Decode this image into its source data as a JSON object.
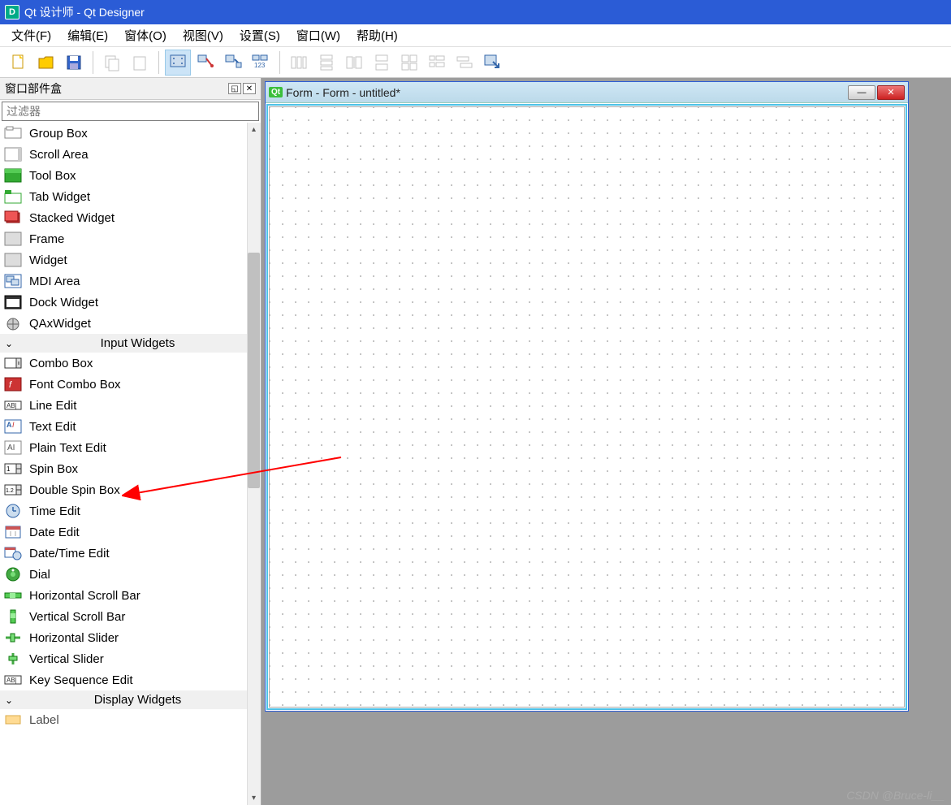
{
  "title": "Qt 设计师 - Qt Designer",
  "menu": [
    "文件(F)",
    "编辑(E)",
    "窗体(O)",
    "视图(V)",
    "设置(S)",
    "窗口(W)",
    "帮助(H)"
  ],
  "dock": {
    "title": "窗口部件盒",
    "filter_placeholder": "过滤器"
  },
  "widgets": {
    "containers": [
      {
        "label": "Group Box",
        "icon": "groupbox"
      },
      {
        "label": "Scroll Area",
        "icon": "scrollarea"
      },
      {
        "label": "Tool Box",
        "icon": "toolbox"
      },
      {
        "label": "Tab Widget",
        "icon": "tabwidget"
      },
      {
        "label": "Stacked Widget",
        "icon": "stacked"
      },
      {
        "label": "Frame",
        "icon": "frame"
      },
      {
        "label": "Widget",
        "icon": "widget"
      },
      {
        "label": "MDI Area",
        "icon": "mdi"
      },
      {
        "label": "Dock Widget",
        "icon": "dock"
      },
      {
        "label": "QAxWidget",
        "icon": "qax"
      }
    ],
    "input_cat": "Input Widgets",
    "inputs": [
      {
        "label": "Combo Box",
        "icon": "combo"
      },
      {
        "label": "Font Combo Box",
        "icon": "fontcombo"
      },
      {
        "label": "Line Edit",
        "icon": "lineedit"
      },
      {
        "label": "Text Edit",
        "icon": "textedit"
      },
      {
        "label": "Plain Text Edit",
        "icon": "plaintext"
      },
      {
        "label": "Spin Box",
        "icon": "spin"
      },
      {
        "label": "Double Spin Box",
        "icon": "dspin"
      },
      {
        "label": "Time Edit",
        "icon": "time"
      },
      {
        "label": "Date Edit",
        "icon": "date"
      },
      {
        "label": "Date/Time Edit",
        "icon": "datetime"
      },
      {
        "label": "Dial",
        "icon": "dial"
      },
      {
        "label": "Horizontal Scroll Bar",
        "icon": "hscroll"
      },
      {
        "label": "Vertical Scroll Bar",
        "icon": "vscroll"
      },
      {
        "label": "Horizontal Slider",
        "icon": "hslider"
      },
      {
        "label": "Vertical Slider",
        "icon": "vslider"
      },
      {
        "label": "Key Sequence Edit",
        "icon": "keyseq"
      }
    ],
    "display_cat": "Display Widgets",
    "display_first": "Label"
  },
  "form": {
    "title": "Form - Form - untitled*"
  },
  "watermark": "CSDN @Bruce-li__"
}
